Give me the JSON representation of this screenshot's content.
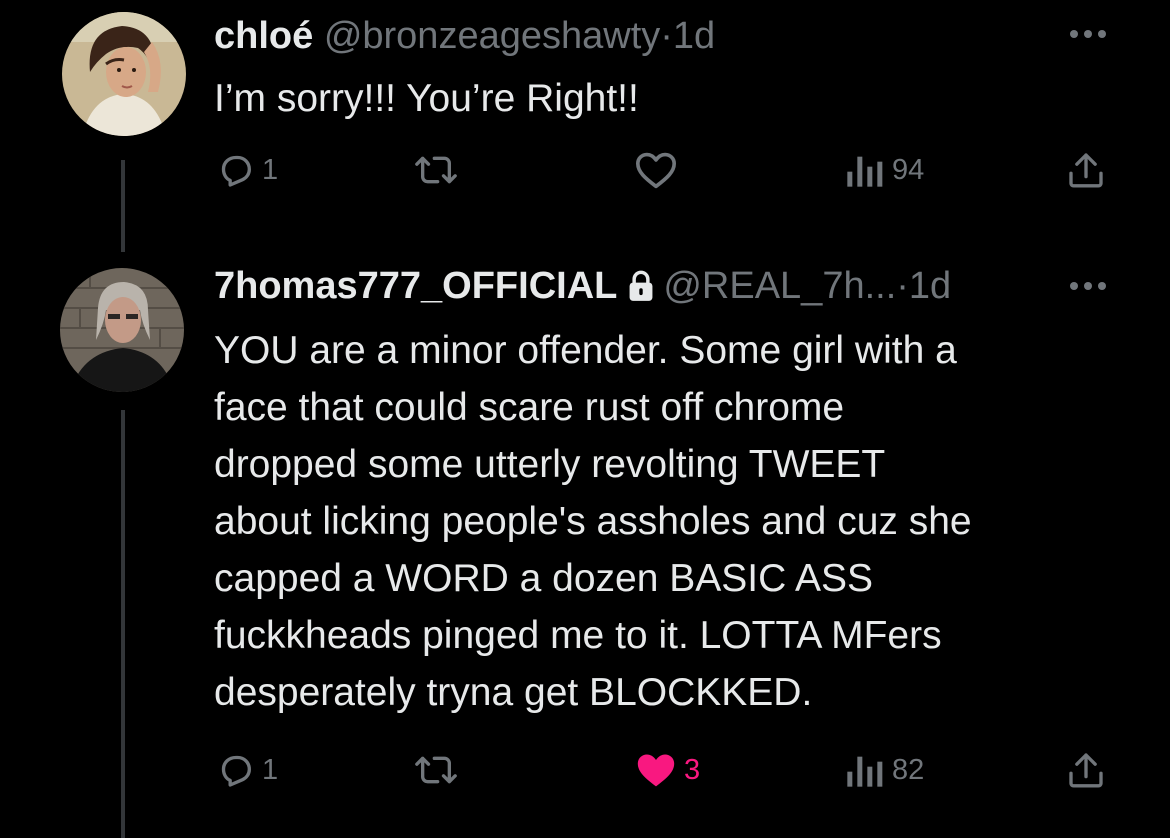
{
  "tweets": [
    {
      "display_name": "chloé",
      "handle": "@bronzeageshawty",
      "separator": "·",
      "time": "1d",
      "text": "I’m sorry!!! You’re Right!!",
      "actions": {
        "reply_count": "1",
        "retweet_count": "",
        "like_count": "",
        "views_count": "94"
      }
    },
    {
      "display_name": "7homas777_OFFICIAL",
      "handle": "@REAL_7h...",
      "separator": "·",
      "time": "1d",
      "protected": true,
      "text_lines": [
        "YOU are a minor offender. Some girl with a",
        "face that could scare rust off chrome",
        "dropped some utterly revolting TWEET",
        "about licking people's assholes and cuz she",
        "capped a WORD a dozen BASIC ASS",
        "fuckkheads pinged me to it. LOTTA MFers",
        "desperately tryna get BLOCKKED."
      ],
      "actions": {
        "reply_count": "1",
        "retweet_count": "",
        "like_count": "3",
        "liked": true,
        "views_count": "82"
      }
    }
  ],
  "icons": {
    "reply": "reply-icon",
    "retweet": "retweet-icon",
    "like": "heart-icon",
    "views": "views-icon",
    "share": "share-icon",
    "more": "more-icon",
    "lock": "lock-icon"
  },
  "colors": {
    "background": "#000000",
    "text": "#e7e9ea",
    "secondary": "#71767b",
    "like_active": "#f91880",
    "thread_line": "#333639"
  }
}
